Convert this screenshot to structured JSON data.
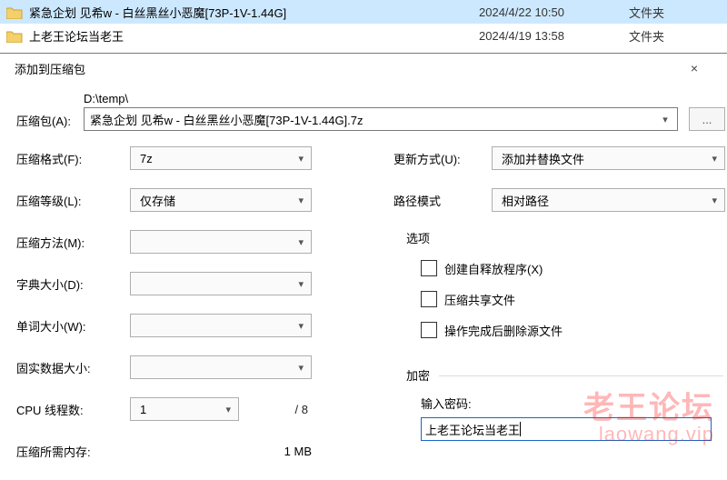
{
  "files": [
    {
      "name": "紧急企划 见希w - 白丝黑丝小恶魔[73P-1V-1.44G]",
      "date": "2024/4/22 10:50",
      "type": "文件夹"
    },
    {
      "name": "上老王论坛当老王",
      "date": "2024/4/19 13:58",
      "type": "文件夹"
    }
  ],
  "dialog": {
    "title": "添加到压缩包",
    "close": "×",
    "archive": {
      "label": "压缩包(A):",
      "dir": "D:\\temp\\",
      "value": "紧急企划 见希w - 白丝黑丝小恶魔[73P-1V-1.44G].7z",
      "browse": "..."
    },
    "left": {
      "format_l": "压缩格式(F):",
      "format_v": "7z",
      "level_l": "压缩等级(L):",
      "level_v": "仅存储",
      "method_l": "压缩方法(M):",
      "method_v": "",
      "dict_l": "字典大小(D):",
      "dict_v": "",
      "word_l": "单词大小(W):",
      "word_v": "",
      "solid_l": "固实数据大小:",
      "solid_v": "",
      "cpu_l": "CPU 线程数:",
      "cpu_v": "1",
      "cpu_aux": "/ 8",
      "ram_l": "压缩所需内存:",
      "ram_v": "1 MB"
    },
    "right": {
      "update_l": "更新方式(U):",
      "update_v": "添加并替换文件",
      "path_l": "路径模式",
      "path_v": "相对路径",
      "options_l": "选项",
      "opt1": "创建自释放程序(X)",
      "opt2": "压缩共享文件",
      "opt3": "操作完成后删除源文件",
      "encrypt_l": "加密",
      "enter_pw_l": "输入密码:",
      "password": "上老王论坛当老王"
    }
  },
  "watermark": {
    "line1": "老王论坛",
    "line2": "laowang.vip"
  }
}
